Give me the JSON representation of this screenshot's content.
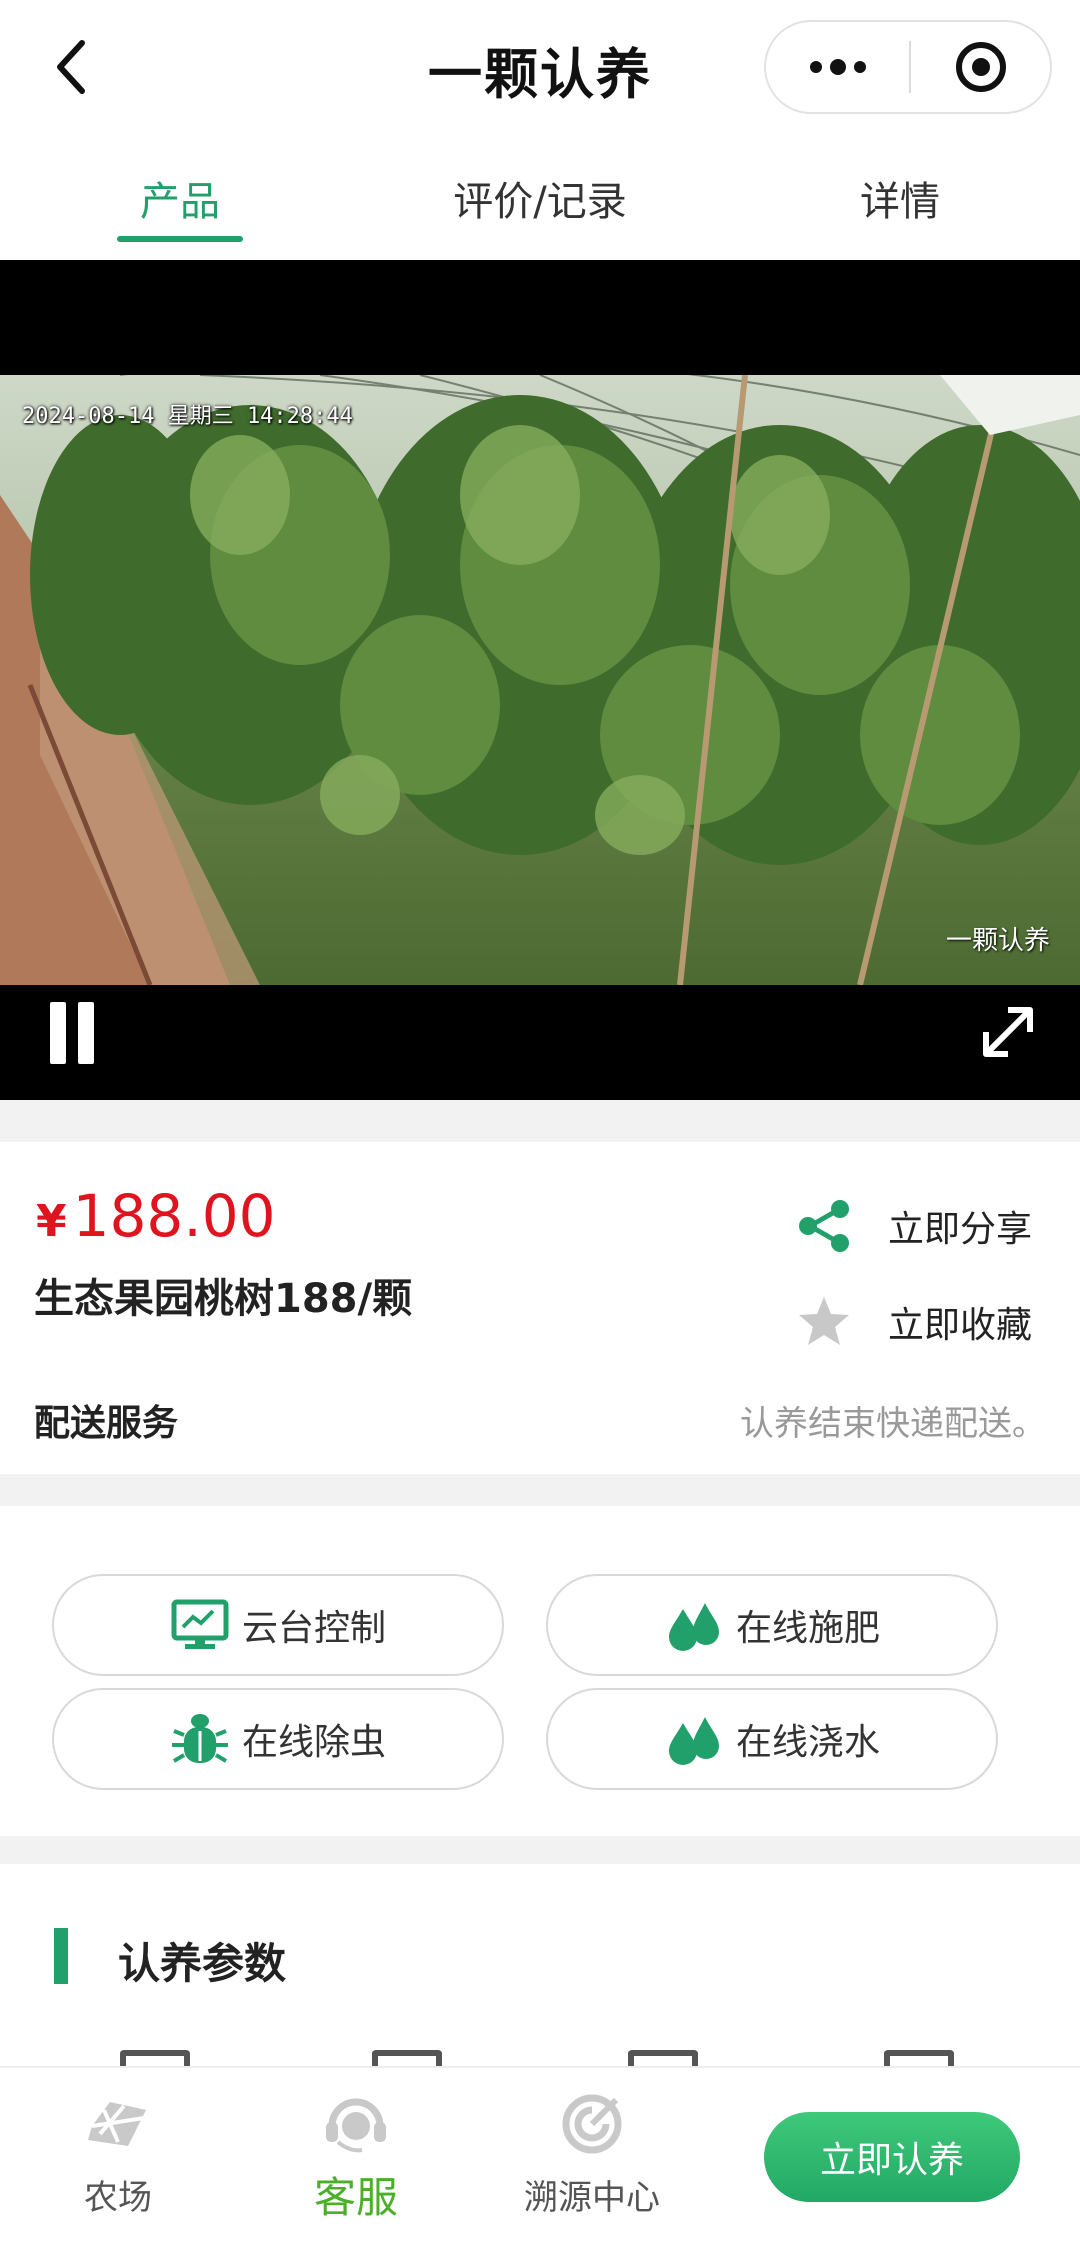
{
  "header": {
    "title": "一颗认养"
  },
  "tabs": [
    {
      "label": "产品",
      "active": true
    },
    {
      "label": "评价/记录",
      "active": false
    },
    {
      "label": "详情",
      "active": false
    }
  ],
  "video": {
    "timestamp": "2024-08-14 星期三 14:28:44",
    "watermark": "一颗认养"
  },
  "product": {
    "currency": "¥",
    "price": "188.00",
    "name": "生态果园桃树188/颗",
    "share_label": "立即分享",
    "favorite_label": "立即收藏",
    "delivery_label": "配送服务",
    "delivery_value": "认养结束快递配送。"
  },
  "operations": [
    {
      "label": "云台控制",
      "icon": "monitor-icon"
    },
    {
      "label": "在线施肥",
      "icon": "drops-icon"
    },
    {
      "label": "在线除虫",
      "icon": "bug-icon"
    },
    {
      "label": "在线浇水",
      "icon": "drops-icon"
    }
  ],
  "params": {
    "title": "认养参数"
  },
  "tabbar": {
    "items": [
      {
        "label": "农场",
        "icon": "farm-icon",
        "active": false
      },
      {
        "label": "客服",
        "icon": "customer-service-icon",
        "active": true
      },
      {
        "label": "溯源中心",
        "icon": "trace-icon",
        "active": false
      }
    ],
    "cta_label": "立即认养"
  },
  "colors": {
    "accent": "#22a06b",
    "price": "#e0141e",
    "tabbar_active": "#4caf2a"
  }
}
